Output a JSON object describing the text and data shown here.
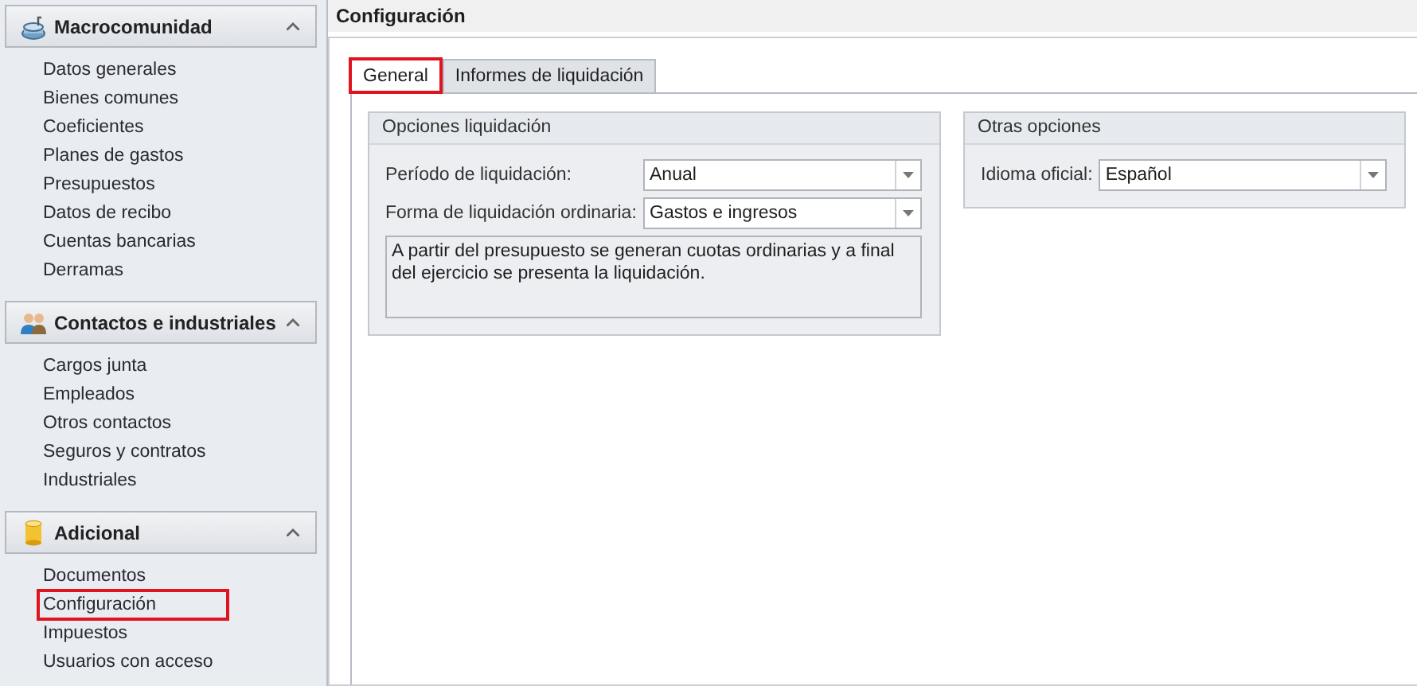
{
  "sidebar": {
    "groups": [
      {
        "title": "Macrocomunidad",
        "expanded": true,
        "items": [
          {
            "label": "Datos generales",
            "highlighted": false
          },
          {
            "label": "Bienes comunes",
            "highlighted": false
          },
          {
            "label": "Coeficientes",
            "highlighted": false
          },
          {
            "label": "Planes de gastos",
            "highlighted": false
          },
          {
            "label": "Presupuestos",
            "highlighted": false
          },
          {
            "label": "Datos de recibo",
            "highlighted": false
          },
          {
            "label": "Cuentas bancarias",
            "highlighted": false
          },
          {
            "label": "Derramas",
            "highlighted": false
          }
        ]
      },
      {
        "title": "Contactos e industriales",
        "expanded": true,
        "items": [
          {
            "label": "Cargos junta",
            "highlighted": false
          },
          {
            "label": "Empleados",
            "highlighted": false
          },
          {
            "label": "Otros contactos",
            "highlighted": false
          },
          {
            "label": "Seguros y contratos",
            "highlighted": false
          },
          {
            "label": "Industriales",
            "highlighted": false
          }
        ]
      },
      {
        "title": "Adicional",
        "expanded": true,
        "items": [
          {
            "label": "Documentos",
            "highlighted": false
          },
          {
            "label": "Configuración",
            "highlighted": true
          },
          {
            "label": "Impuestos",
            "highlighted": false
          },
          {
            "label": "Usuarios con acceso",
            "highlighted": false
          }
        ]
      }
    ]
  },
  "header": {
    "title": "Configuración"
  },
  "tabs": [
    {
      "label": "General",
      "selected": true,
      "highlighted": true
    },
    {
      "label": "Informes de liquidación",
      "selected": false,
      "highlighted": false
    }
  ],
  "panels": [
    {
      "title": "Opciones liquidación",
      "fields": [
        {
          "kind": "combo",
          "label": "Período de liquidación:",
          "value": "Anual"
        },
        {
          "kind": "combo",
          "label": "Forma de liquidación ordinaria:",
          "value": "Gastos e ingresos"
        },
        {
          "kind": "memo",
          "value": "A partir del presupuesto se generan cuotas ordinarias y a final del ejercicio se presenta la liquidación."
        }
      ]
    },
    {
      "title": "Otras opciones",
      "fields": [
        {
          "kind": "combo",
          "label": "Idioma oficial:",
          "value": "Español"
        }
      ]
    }
  ]
}
